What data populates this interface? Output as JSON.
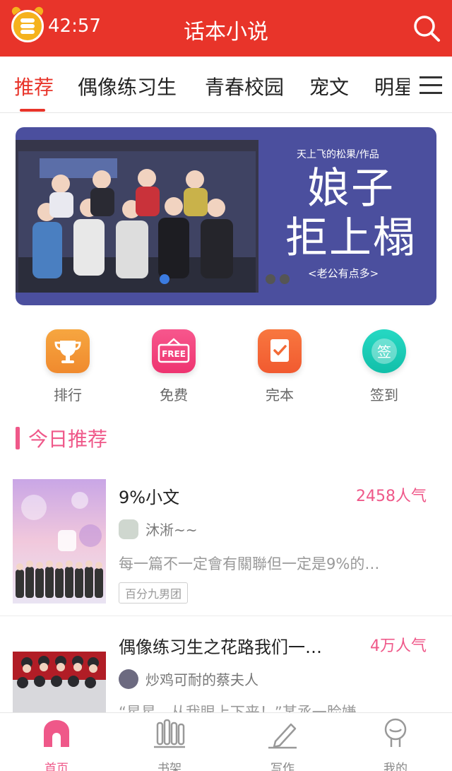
{
  "header": {
    "timer": "42:57",
    "title": "话本小说",
    "icons": {
      "timer": "alarm-coin-icon",
      "search": "search-icon"
    },
    "colors": {
      "brand": "#e8342a"
    }
  },
  "tabs": {
    "items": [
      "推荐",
      "偶像练习生",
      "青春校园",
      "宠文",
      "明星"
    ],
    "active_index": 0,
    "more_icon": "menu-icon"
  },
  "banner": {
    "subtitle": "天上飞的松果/作品",
    "title_line1": "娘子",
    "title_line2": "拒上榻",
    "tagline": "<老公有点多>"
  },
  "quick_nav": [
    {
      "label": "排行",
      "icon": "trophy-icon",
      "color": "#f39c3a"
    },
    {
      "label": "免费",
      "icon": "free-sign-icon",
      "color": "#f2457b",
      "icon_text": "FREE"
    },
    {
      "label": "完本",
      "icon": "checklist-icon",
      "color": "#f5653a"
    },
    {
      "label": "签到",
      "icon": "signin-icon",
      "color": "#19cbb6",
      "icon_text": "签"
    }
  ],
  "section": {
    "title": "今日推荐"
  },
  "books": [
    {
      "title": "9%小文",
      "popularity": "2458人气",
      "author": "沐淅~~",
      "description": "每一篇不一定會有關聯但一定是9%的…",
      "tag": "百分九男团"
    },
    {
      "title": "偶像练习生之花路我们一…",
      "popularity": "4万人气",
      "author": "炒鸡可耐的蔡夫人",
      "description": "“星星，从我眼上下来！”某丞一脸嫌…"
    }
  ],
  "bottom_nav": [
    {
      "label": "首页",
      "icon": "home-icon"
    },
    {
      "label": "书架",
      "icon": "bookshelf-icon"
    },
    {
      "label": "写作",
      "icon": "pen-icon"
    },
    {
      "label": "我的",
      "icon": "profile-icon"
    }
  ],
  "bottom_active_index": 0,
  "colors": {
    "accent_pink": "#ef5889"
  }
}
